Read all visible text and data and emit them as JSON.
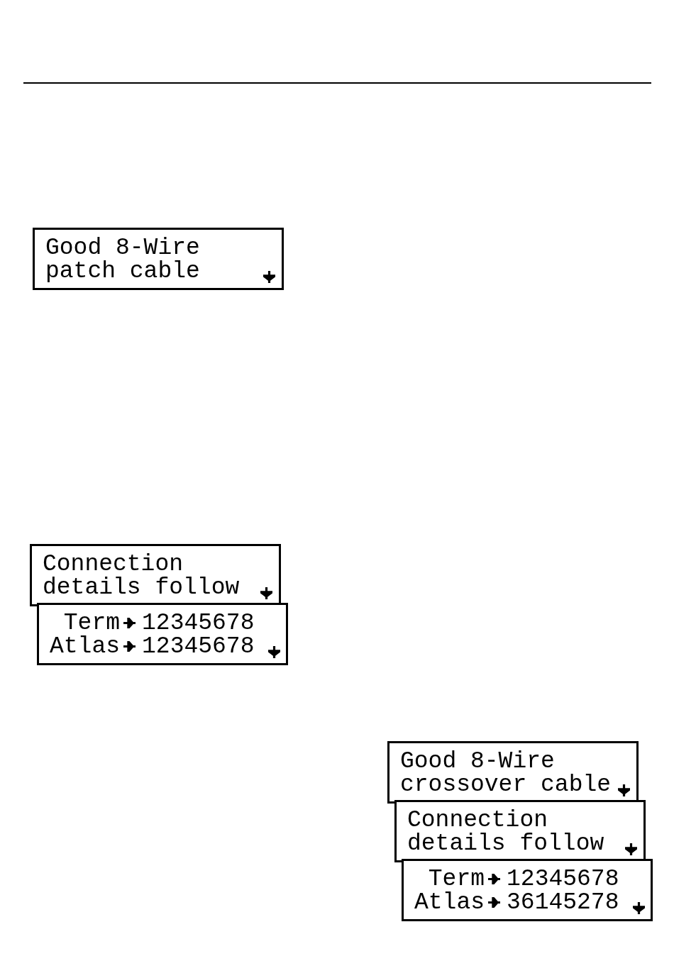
{
  "displays": [
    {
      "screens": [
        {
          "kind": "message",
          "lines": [
            "Good 8-Wire",
            "patch cable"
          ]
        }
      ]
    },
    {
      "screens": [
        {
          "kind": "message",
          "lines": [
            "Connection",
            "details follow"
          ]
        },
        {
          "kind": "wiremap",
          "rows": [
            {
              "label": "Term",
              "value": "12345678"
            },
            {
              "label": "Atlas",
              "value": "12345678"
            }
          ]
        }
      ]
    },
    {
      "screens": [
        {
          "kind": "message",
          "lines": [
            "Good 8-Wire",
            "crossover cable"
          ]
        },
        {
          "kind": "message",
          "lines": [
            "Connection",
            "details follow"
          ]
        },
        {
          "kind": "wiremap",
          "rows": [
            {
              "label": "Term",
              "value": "12345678"
            },
            {
              "label": "Atlas",
              "value": "36145278"
            }
          ]
        }
      ]
    }
  ]
}
